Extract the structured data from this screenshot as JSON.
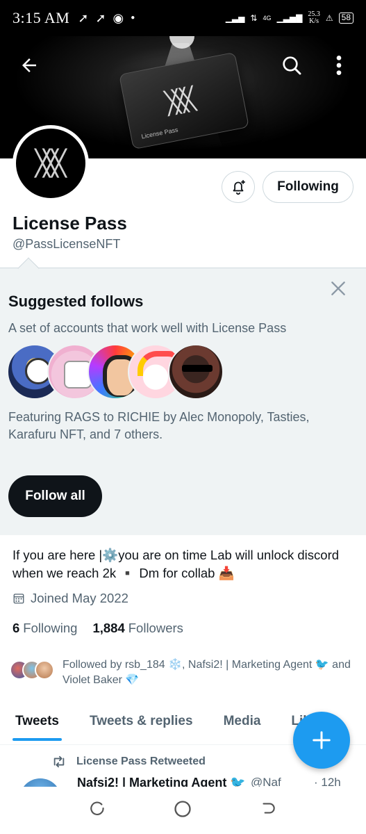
{
  "status_bar": {
    "time": "3:15 AM",
    "network": "4G",
    "speed_value": "25.3",
    "speed_unit": "K/s",
    "battery": "58"
  },
  "header": {
    "card_text": "License Pass",
    "banner_colors": {
      "background": "#000000"
    }
  },
  "profile": {
    "name": "License Pass",
    "handle": "@PassLicenseNFT",
    "following_button": "Following",
    "bio": "If you are here |⚙️you are on time Lab will unlock discord when we reach 2k ▪️ Dm for collab 📥",
    "joined": "Joined May 2022",
    "following_count": "6",
    "following_label": "Following",
    "followers_count": "1,884",
    "followers_label": "Followers",
    "followed_by": "Followed by rsb_184 ❄️, Nafsi2! | Marketing Agent 🐦 and Violet Baker 💎"
  },
  "suggested": {
    "title": "Suggested follows",
    "subtitle": "A set of accounts that work well with License Pass",
    "featuring": "Featuring RAGS to RICHIE by Alec Monopoly, Tasties, Karafuru NFT, and 7 others.",
    "follow_all": "Follow all"
  },
  "tabs": [
    {
      "label": "Tweets"
    },
    {
      "label": "Tweets & replies"
    },
    {
      "label": "Media"
    },
    {
      "label": "Likes"
    }
  ],
  "tweet": {
    "retweeted_label": "License Pass Retweeted",
    "author_name": "Nafsi2! | Marketing Agent 🐦",
    "author_handle": "@Naf",
    "time": "· 12h"
  },
  "icons": {
    "back": "arrow-left-icon",
    "search": "search-icon",
    "more": "more-vertical-icon",
    "bell": "bell-plus-icon",
    "close": "close-icon",
    "calendar": "calendar-icon",
    "retweet": "retweet-icon",
    "compose": "plus-icon"
  },
  "colors": {
    "accent": "#1d9bf0",
    "text_primary": "#0f1419",
    "text_secondary": "#536471",
    "suggest_bg": "#eff3f4"
  }
}
